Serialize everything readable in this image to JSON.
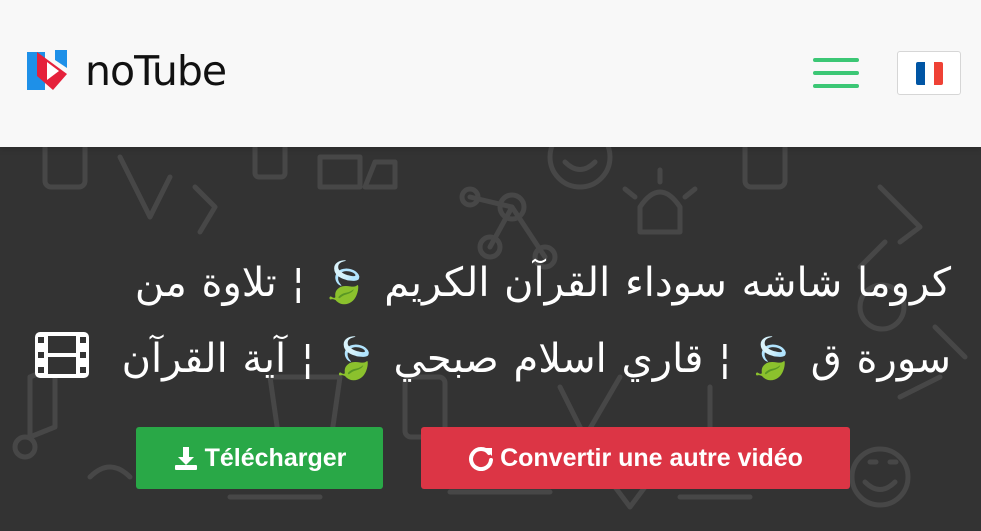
{
  "header": {
    "logo_text": "noTube",
    "menu_icon": "hamburger-menu-icon",
    "language_flag": "france-flag-icon",
    "flag_colors": [
      "#0055a4",
      "#ffffff",
      "#ef4135"
    ],
    "menu_color": "#3cc775"
  },
  "hero": {
    "title": "كروما شاشه سوداء القرآن الكريم 🍃 ¦ تلاوة من سورة ق 🍃 ¦ قاري اسلام صبحي 🍃 ¦ آية القرآن",
    "title_icon": "film-icon",
    "background": "#333333"
  },
  "actions": {
    "download_label": "Télécharger",
    "download_icon": "download-icon",
    "download_color": "#29a847",
    "convert_label": "Convertir une autre vidéo",
    "convert_icon": "refresh-icon",
    "convert_color": "#dc3545"
  }
}
